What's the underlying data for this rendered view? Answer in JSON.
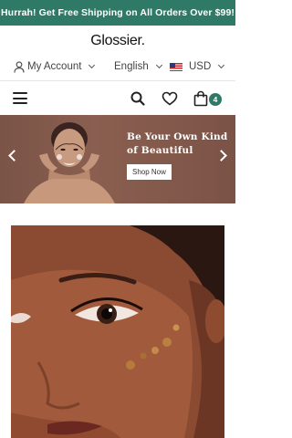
{
  "promo": {
    "text": "Hurrah! Get Free Shipping on All Orders Over $99!"
  },
  "header": {
    "logo": "Glossier."
  },
  "utility": {
    "account_label": "My Account",
    "language_label": "English",
    "currency_label": "USD"
  },
  "nav": {
    "cart_count": "4"
  },
  "hero": {
    "title_line1": "Be Your Own Kind",
    "title_line2": "of Beautiful",
    "button_label": "Shop Now"
  },
  "colors": {
    "brand_green": "#2f7a67",
    "hero_bg": "#7a5447"
  },
  "icons": [
    "user-icon",
    "chevron-down-icon",
    "us-flag-icon",
    "menu-icon",
    "search-icon",
    "heart-icon",
    "shopping-bag-icon",
    "arrow-left-icon",
    "arrow-right-icon"
  ]
}
